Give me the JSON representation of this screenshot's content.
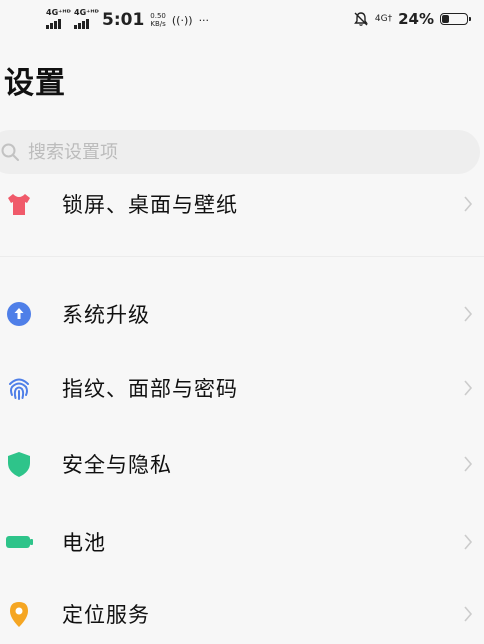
{
  "status_bar": {
    "network_1": "4G⁺ᴴᴰ",
    "network_2": "4G⁺ᴴᴰ",
    "time": "5:01",
    "speed_value": "0.50",
    "speed_unit": "KB/s",
    "hotspot": "((·))",
    "more": "···",
    "right_network": "4G†",
    "battery_percent": "24%"
  },
  "page": {
    "title": "设置"
  },
  "search": {
    "placeholder": "搜索设置项"
  },
  "menu": {
    "items": [
      {
        "label": "锁屏、桌面与壁纸",
        "icon": "tshirt-icon",
        "color": "#f05a6a"
      },
      {
        "label": "系统升级",
        "icon": "upgrade-arrow-icon",
        "color": "#4f7fe8"
      },
      {
        "label": "指纹、面部与密码",
        "icon": "fingerprint-icon",
        "color": "#4f7fe8"
      },
      {
        "label": "安全与隐私",
        "icon": "shield-icon",
        "color": "#2ec48a"
      },
      {
        "label": "电池",
        "icon": "battery-icon",
        "color": "#2ec48a"
      },
      {
        "label": "定位服务",
        "icon": "location-pin-icon",
        "color": "#f5a623"
      }
    ]
  }
}
